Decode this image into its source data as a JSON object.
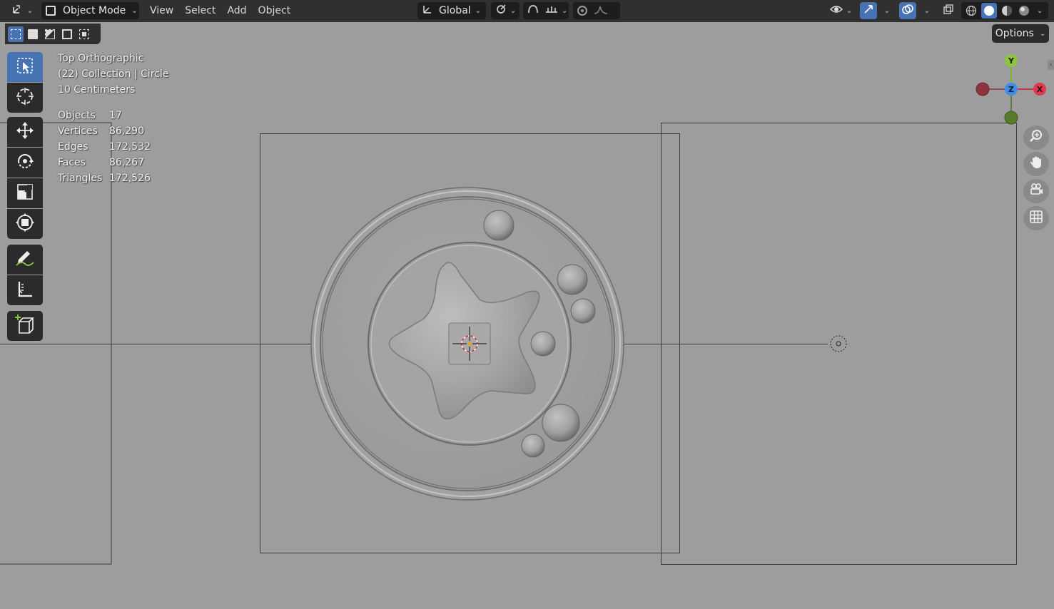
{
  "header": {
    "editor_type_icon": "viewport-icon",
    "mode_label": "Object Mode",
    "menus": [
      "View",
      "Select",
      "Add",
      "Object"
    ],
    "orientation_label": "Global",
    "shading_modes": [
      "wireframe",
      "solid",
      "material-preview",
      "rendered"
    ],
    "shading_active": "solid"
  },
  "options_label": "Options",
  "toolbar": [
    "select-box",
    "cursor",
    "move",
    "rotate",
    "scale",
    "transform",
    "annotate",
    "measure",
    "add-cube"
  ],
  "overlay": {
    "view_name": "Top Orthographic",
    "collection": "(22) Collection | Circle",
    "scale": "10 Centimeters",
    "stats": [
      {
        "label": "Objects",
        "value": "17"
      },
      {
        "label": "Vertices",
        "value": "86,290"
      },
      {
        "label": "Edges",
        "value": "172,532"
      },
      {
        "label": "Faces",
        "value": "86,267"
      },
      {
        "label": "Triangles",
        "value": "172,526"
      }
    ]
  },
  "gizmo": {
    "y": "Y",
    "z": "Z",
    "x": "X"
  },
  "colors": {
    "accent": "#4772b3",
    "x_axis": "#e0384f",
    "y_axis": "#8cc63f",
    "z_axis": "#3c8ee8",
    "viewport_bg": "#9d9d9d"
  }
}
